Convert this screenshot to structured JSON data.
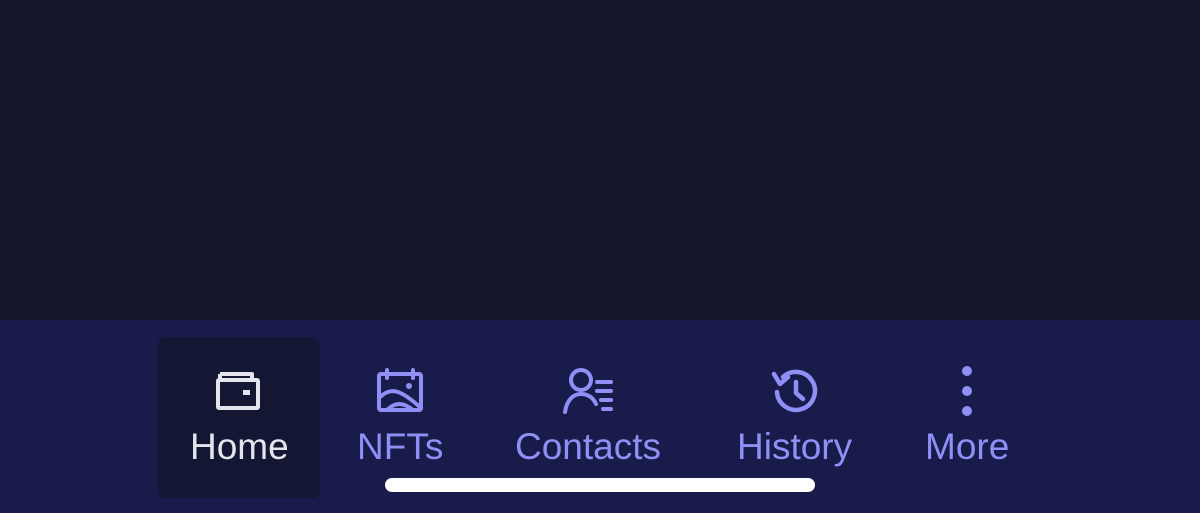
{
  "tab_bar": {
    "active_color": "#e4e4ec",
    "inactive_color": "#8f8ff5",
    "background": "#191c4b",
    "tabs": [
      {
        "label": "Home",
        "icon": "wallet-icon",
        "active": true
      },
      {
        "label": "NFTs",
        "icon": "nft-image-icon",
        "active": false
      },
      {
        "label": "Contacts",
        "icon": "contacts-icon",
        "active": false
      },
      {
        "label": "History",
        "icon": "history-icon",
        "active": false
      },
      {
        "label": "More",
        "icon": "more-vertical-icon",
        "active": false
      }
    ]
  }
}
